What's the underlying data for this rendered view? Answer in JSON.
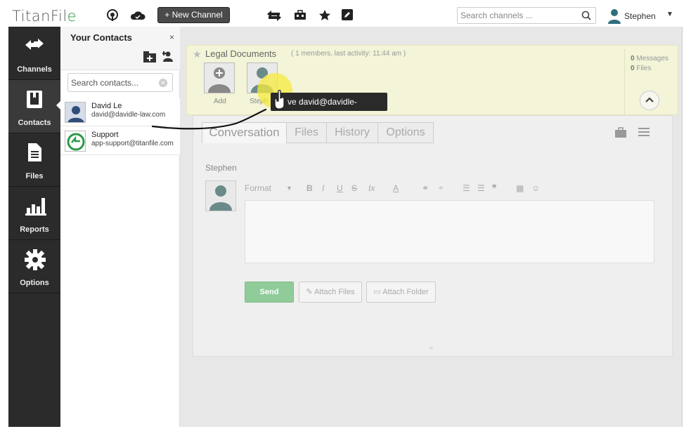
{
  "app": {
    "logo_text": "TitanFil",
    "logo_accent": "e",
    "new_channel_label": "+ New Channel",
    "search_placeholder": "Search channels ...",
    "user_name": "Stephen"
  },
  "icons": [
    "podcast-icon",
    "cloud-icon",
    "transfer-icon",
    "briefcase-icon",
    "star-icon",
    "edit-icon",
    "search-icon",
    "user-icon",
    "caret-down-icon"
  ],
  "nav": {
    "items": [
      {
        "label": "Channels",
        "icon": "arrows-icon"
      },
      {
        "label": "Contacts",
        "icon": "book-icon"
      },
      {
        "label": "Files",
        "icon": "file-icon"
      },
      {
        "label": "Reports",
        "icon": "bar-chart-icon"
      },
      {
        "label": "Options",
        "icon": "gear-icon"
      }
    ]
  },
  "contacts": {
    "title": "Your Contacts",
    "close": "×",
    "search_placeholder": "Search contacts...",
    "items": [
      {
        "name": "David Le",
        "email": "david@davidle-law.com"
      },
      {
        "name": "Support",
        "email": "app-support@titanfile.com"
      }
    ]
  },
  "channel": {
    "name": "Legal Documents",
    "meta": "( 1 members, last activity: 11:44 am )",
    "messages_count": "0",
    "messages_label": "Messages",
    "files_count": "0",
    "files_label": "Files",
    "members": [
      {
        "label": "Add"
      },
      {
        "label": "Steph"
      }
    ],
    "tooltip": "ve david@davidle-law.com"
  },
  "conversation": {
    "tabs": [
      "Conversation",
      "Files",
      "History",
      "Options"
    ],
    "active_tab": "Conversation",
    "author": "Stephen",
    "format_label": "Format",
    "toolbar_glyphs": [
      "B",
      "I",
      "U",
      "S",
      "Ix",
      "A"
    ],
    "send_label": "Send",
    "attach_files_label": "Attach Files",
    "attach_folder_label": "Attach Folder"
  },
  "colors": {
    "nav_bg": "#2b2b2b",
    "channel_bg": "#f3f4d8",
    "send_bg": "#8fcc9a",
    "logo_accent": "#2a9a4a"
  }
}
